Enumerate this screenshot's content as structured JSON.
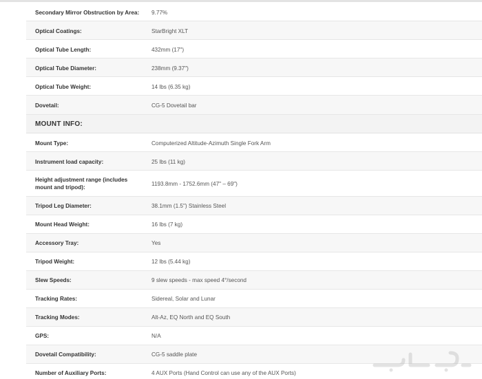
{
  "specs_top": [
    {
      "label": "Secondary Mirror Obstruction by Area:",
      "value": "9.77%"
    },
    {
      "label": "Optical Coatings:",
      "value": "StarBright XLT"
    },
    {
      "label": "Optical Tube Length:",
      "value": "432mm (17\")"
    },
    {
      "label": "Optical Tube Diameter:",
      "value": "238mm (9.37\")"
    },
    {
      "label": "Optical Tube Weight:",
      "value": "14 lbs (6.35 kg)"
    },
    {
      "label": "Dovetail:",
      "value": "CG-5 Dovetail bar"
    }
  ],
  "section_title": "MOUNT INFO:",
  "specs_mount": [
    {
      "label": "Mount Type:",
      "value": "Computerized Altitude-Azimuth Single Fork Arm"
    },
    {
      "label": "Instrument load capacity:",
      "value": "25 lbs (11 kg)"
    },
    {
      "label": "Height adjustment range (includes mount and tripod):",
      "value": "1193.8mm - 1752.6mm (47\" – 69\")"
    },
    {
      "label": "Tripod Leg Diameter:",
      "value": "38.1mm (1.5\") Stainless Steel"
    },
    {
      "label": "Mount Head Weight:",
      "value": "16 lbs (7 kg)"
    },
    {
      "label": "Accessory Tray:",
      "value": "Yes"
    },
    {
      "label": "Tripod Weight:",
      "value": "12 lbs (5.44 kg)"
    },
    {
      "label": "Slew Speeds:",
      "value": "9 slew speeds - max speed 4°/second"
    },
    {
      "label": "Tracking Rates:",
      "value": "Sidereal, Solar and Lunar"
    },
    {
      "label": "Tracking Modes:",
      "value": "Alt-Az, EQ North and EQ South"
    },
    {
      "label": "GPS:",
      "value": "N/A"
    },
    {
      "label": "Dovetail Compatibility:",
      "value": "CG-5 saddle plate"
    },
    {
      "label": "Number of Auxiliary Ports:",
      "value": "4 AUX Ports (Hand Control can use any of the AUX Ports)"
    }
  ],
  "watermark_text": "حراج"
}
